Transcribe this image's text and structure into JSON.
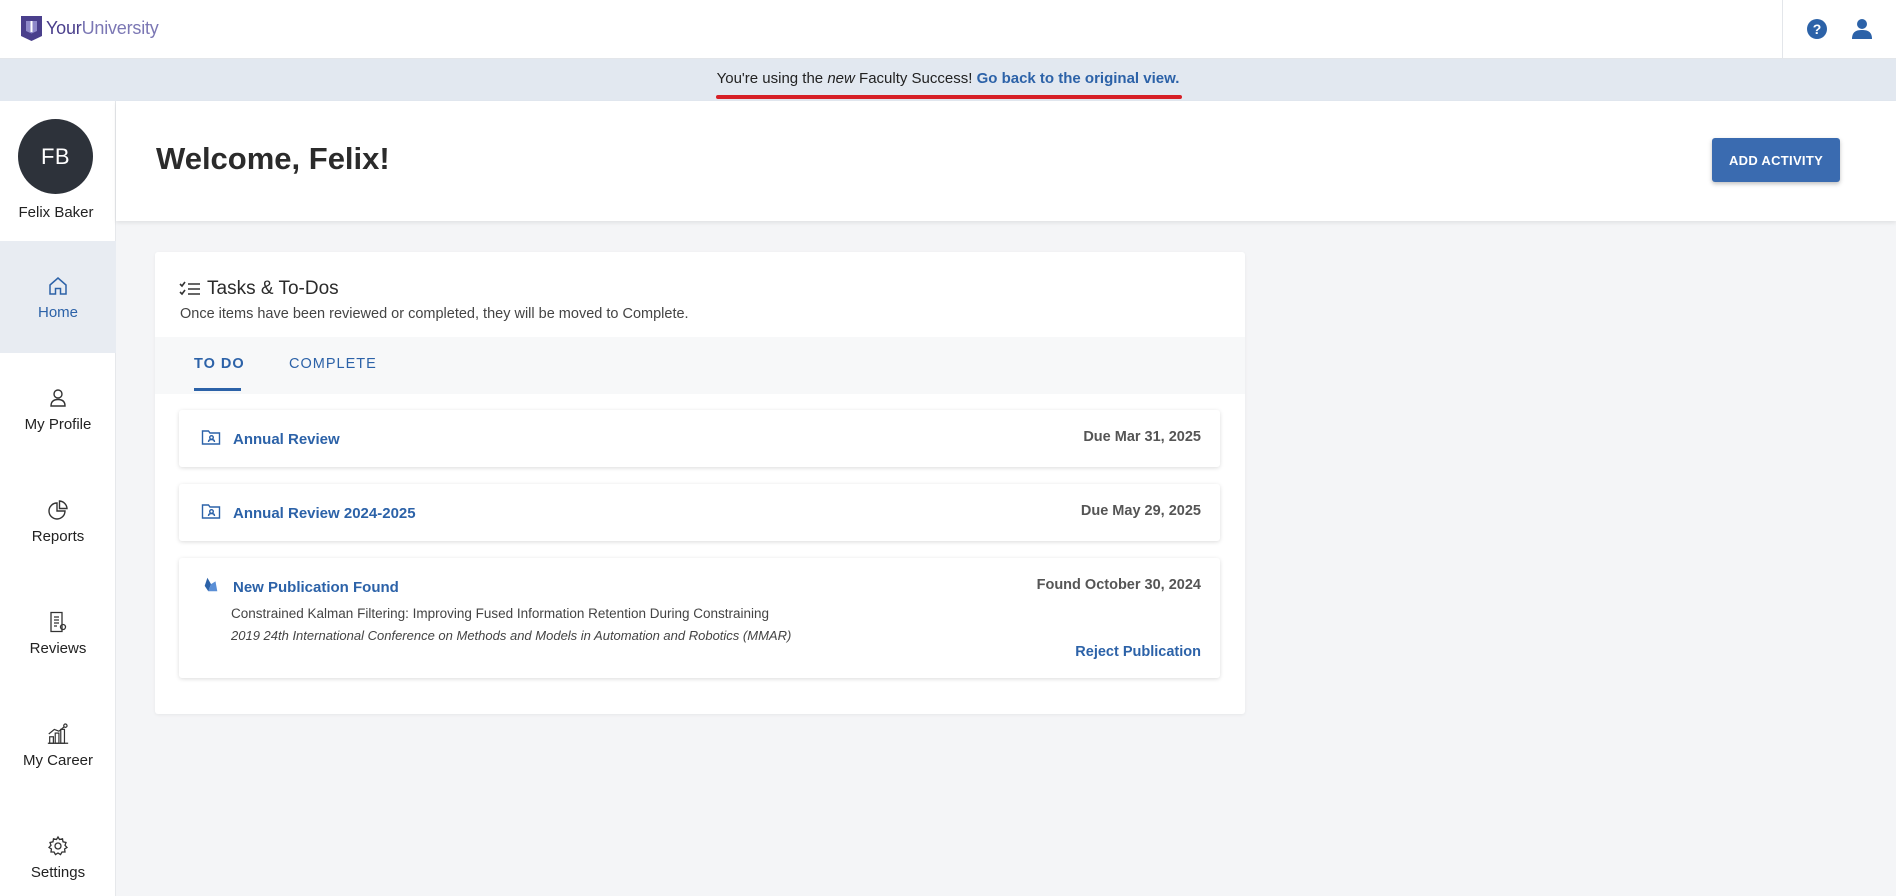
{
  "brand": {
    "your": "Your",
    "university": "University"
  },
  "notice": {
    "prefix": "You're using the ",
    "emphasis": "new",
    "middle": " Faculty Success! ",
    "link": "Go back to the original view."
  },
  "user": {
    "initials": "FB",
    "name": "Felix Baker"
  },
  "nav": [
    {
      "label": "Home",
      "icon": "home-icon",
      "active": true
    },
    {
      "label": "My Profile",
      "icon": "person-icon"
    },
    {
      "label": "Reports",
      "icon": "pie-chart-icon"
    },
    {
      "label": "Reviews",
      "icon": "document-icon"
    },
    {
      "label": "My Career",
      "icon": "career-chart-icon"
    },
    {
      "label": "Settings",
      "icon": "gear-icon"
    }
  ],
  "welcome": {
    "title": "Welcome, Felix!",
    "add_button": "ADD ACTIVITY"
  },
  "tasks": {
    "title": "Tasks & To-Dos",
    "subtitle": "Once items have been reviewed or completed, they will be moved to Complete.",
    "tabs": [
      {
        "label": "TO DO",
        "active": true
      },
      {
        "label": "COMPLETE"
      }
    ],
    "items": [
      {
        "title": "Annual Review",
        "due": "Due Mar 31, 2025",
        "icon": "folder-user-icon"
      },
      {
        "title": "Annual Review 2024-2025",
        "due": "Due May 29, 2025",
        "icon": "folder-user-icon"
      },
      {
        "title": "New Publication Found",
        "due": "Found October 30, 2024",
        "icon": "publication-icon",
        "publication": "Constrained Kalman Filtering: Improving Fused Information Retention During Constraining",
        "venue": "2019 24th International Conference on Methods and Models in Automation and Robotics (MMAR)",
        "action": "Reject Publication"
      }
    ]
  },
  "colors": {
    "accent": "#2c62a8",
    "button": "#3a6bb0",
    "avatar": "#2d323a",
    "notice_bg": "#e2e8f0",
    "notice_underline": "#d61f26"
  }
}
